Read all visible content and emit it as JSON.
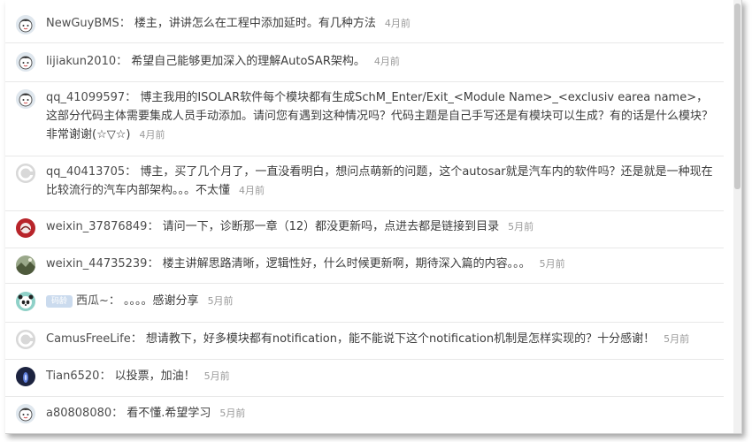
{
  "comments": [
    {
      "user": "NewGuyBMS",
      "text": "楼主，讲讲怎么在工程中添加延时。有几种方法",
      "time": "4月前",
      "avatar": "cartoon-boy-icon"
    },
    {
      "user": "lijiakun2010",
      "text": "希望自己能够更加深入的理解AutoSAR架构。",
      "time": "4月前",
      "avatar": "cartoon-boy-icon"
    },
    {
      "user": "qq_41099597",
      "text": "博主我用的ISOLAR软件每个模块都有生成SchM_Enter/Exit_<Module Name>_<exclusiv earea name>，这部分代码主体需要集成人员手动添加。请问您有遇到这种情况吗？代码主题是自己手写还是有模块可以生成？有的话是什么模块？非常谢谢(☆▽☆)",
      "time": "4月前",
      "avatar": "cartoon-boy-icon"
    },
    {
      "user": "qq_40413705",
      "text": "博主，买了几个月了，一直没看明白，想问点萌新的问题，这个autosar就是汽车内的软件吗？还是就是一种现在比较流行的汽车内部架构。。。不太懂",
      "time": "4月前",
      "avatar": "c-logo-icon"
    },
    {
      "user": "weixin_37876849",
      "text": "请问一下，诊断那一章（12）都没更新吗，点进去都是链接到目录",
      "time": "5月前",
      "avatar": "red-photo-icon"
    },
    {
      "user": "weixin_44735239",
      "text": "楼主讲解思路清晰，逻辑性好，什么时候更新啊，期待深入篇的内容。。。",
      "time": "5月前",
      "avatar": "landscape-photo-icon"
    },
    {
      "user": "西瓜~",
      "badge": "码龄",
      "text": "。。。。感谢分享",
      "time": "5月前",
      "avatar": "panda-icon"
    },
    {
      "user": "CamusFreeLife",
      "text": "想请教下，好多模块都有notification，能不能说下这个notification机制是怎样实现的？十分感谢！",
      "time": "5月前",
      "avatar": "c-logo-icon"
    },
    {
      "user": "Tian6520",
      "text": "以投票，加油！",
      "time": "5月前",
      "avatar": "dark-photo-icon"
    },
    {
      "user": "a80808080",
      "text": "看不懂.希望学习",
      "time": "5月前",
      "avatar": "cartoon-boy-icon"
    }
  ],
  "colors": {
    "username": "#4d4d4d",
    "text": "#3d3d3d",
    "time": "#999999",
    "divider": "#e8e8e8",
    "badge": "#cbdbee"
  }
}
